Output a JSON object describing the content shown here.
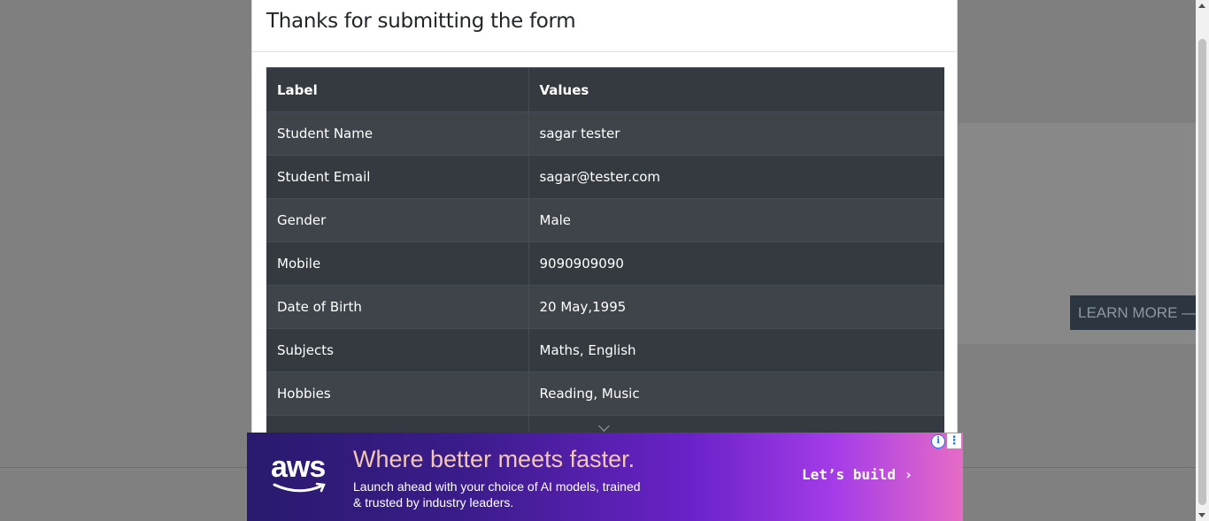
{
  "background": {
    "learn_more_label": "LEARN MORE —"
  },
  "modal": {
    "title": "Thanks for submitting the form",
    "table": {
      "headers": [
        "Label",
        "Values"
      ],
      "rows": [
        {
          "label": "Student Name",
          "value": "sagar tester"
        },
        {
          "label": "Student Email",
          "value": "sagar@tester.com"
        },
        {
          "label": "Gender",
          "value": "Male"
        },
        {
          "label": "Mobile",
          "value": "9090909090"
        },
        {
          "label": "Date of Birth",
          "value": "20 May,1995"
        },
        {
          "label": "Subjects",
          "value": "Maths, English"
        },
        {
          "label": "Hobbies",
          "value": "Reading, Music"
        }
      ]
    }
  },
  "ad": {
    "logo_text": "aws",
    "headline": "Where better meets faster.",
    "subtext": "Launch ahead with your choice of AI models, trained & trusted by industry leaders.",
    "cta_label": "Let’s build ›",
    "info_icon": "info-icon",
    "menu_icon": "more-vertical-icon"
  },
  "colors": {
    "table_dark": "#343a40",
    "table_striped": "#3e444a",
    "overlay": "#808080",
    "ad_headline": "#f3c7b6"
  }
}
